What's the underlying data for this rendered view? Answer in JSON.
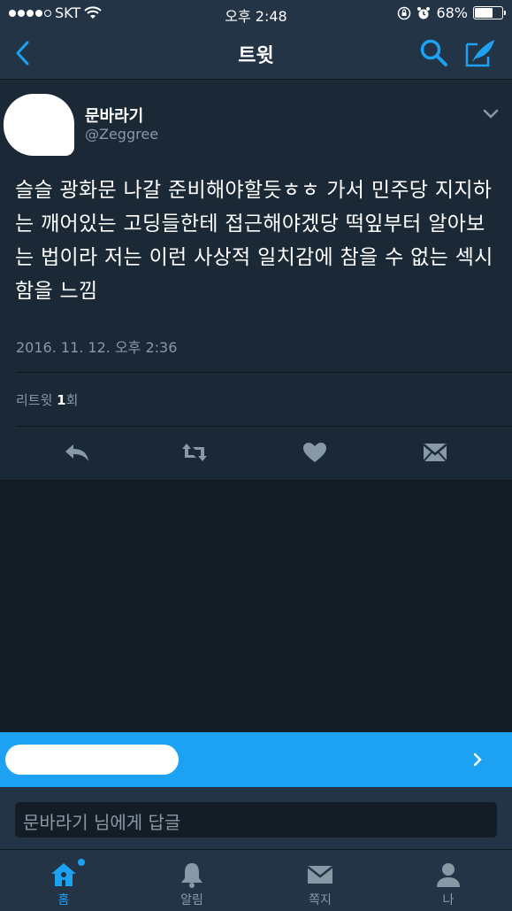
{
  "status_bar": {
    "carrier": "SKT",
    "time": "오후 2:48",
    "battery_percent": "68%",
    "battery_level": 0.68,
    "signal_bars": 4
  },
  "nav": {
    "title": "트윗",
    "icons": [
      "back-icon",
      "search-icon",
      "compose-icon"
    ]
  },
  "tweet": {
    "author_name": "문바라기",
    "author_handle": "@Zeggree",
    "text": "슬슬 광화문 나갈 준비해야할듯ㅎㅎ 가서 민주당 지지하는 깨어있는 고딩들한테 접근해야겠당 떡잎부터 알아보는 법이라 저는 이런 사상적 일치감에 참을 수 없는 섹시함을 느낌",
    "timestamp": "2016. 11. 12. 오후 2:36",
    "retweet_prefix": "리트윗 ",
    "retweet_count": "1",
    "retweet_suffix": "회",
    "actions": [
      "reply-icon",
      "retweet-icon",
      "like-icon",
      "direct-message-icon"
    ]
  },
  "reply": {
    "placeholder": "문바라기 님에게 답글"
  },
  "tabbar": {
    "items": [
      {
        "label": "홈",
        "icon": "home-icon",
        "active": true,
        "has_notification": true
      },
      {
        "label": "알림",
        "icon": "bell-icon",
        "active": false
      },
      {
        "label": "쪽지",
        "icon": "envelope-icon",
        "active": false
      },
      {
        "label": "나",
        "icon": "person-icon",
        "active": false
      }
    ]
  },
  "colors": {
    "accent": "#1da1f2",
    "background": "#141d26",
    "card": "#1b2836",
    "bar": "#243447",
    "muted": "#8899a6"
  }
}
